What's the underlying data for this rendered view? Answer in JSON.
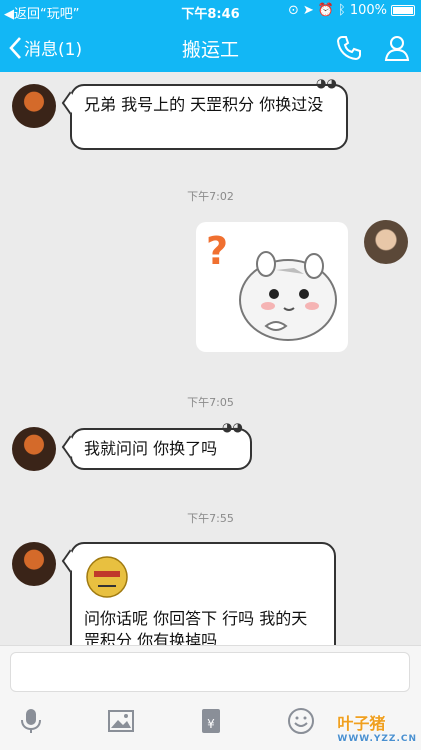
{
  "status_bar": {
    "back_app": "◀返回“玩吧”",
    "time": "下午8:46",
    "battery": "100%"
  },
  "nav": {
    "back_label": "消息(1)",
    "title": "搬运工"
  },
  "messages": [
    {
      "text": "兄弟 我号上的 天罡积分 你换过没"
    },
    {
      "timestamp": "下午7:02"
    },
    {
      "timestamp": "下午7:05"
    },
    {
      "text": "我就问问  你换了吗"
    },
    {
      "timestamp": "下午7:55"
    },
    {
      "text": "问你话呢 你回答下 行吗 我的天罡积分 你有换掉吗"
    }
  ],
  "input": {
    "placeholder": ""
  },
  "watermark": {
    "brand": "叶子猪",
    "url": "WWW.YZZ.CN"
  },
  "colors": {
    "accent": "#12b7f5",
    "chat_bg": "#ebebeb"
  },
  "icons": {
    "phone": "phone-icon",
    "profile": "profile-icon",
    "mic": "microphone-icon",
    "image": "image-icon",
    "red_packet": "red-packet-icon",
    "emoji": "emoji-icon"
  }
}
